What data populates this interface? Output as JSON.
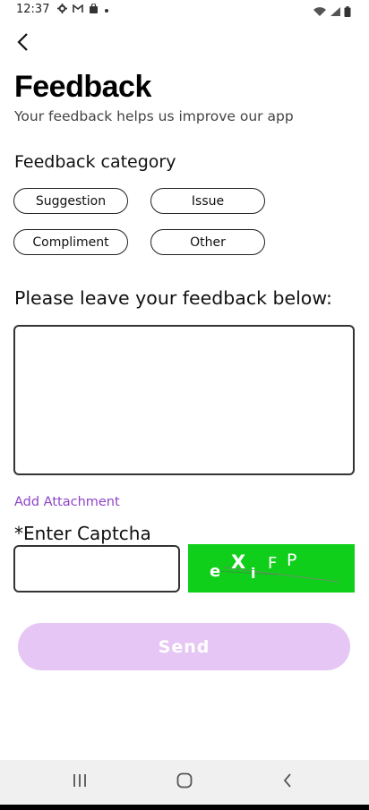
{
  "status_bar": {
    "time": "12:37",
    "left_icons": [
      "gear-icon",
      "gmail-icon",
      "shopping-bag-icon",
      "dot-icon"
    ],
    "right_icons": [
      "wifi-icon",
      "signal-icon",
      "battery-icon"
    ]
  },
  "header": {
    "back_icon": "chevron-left-icon",
    "title": "Feedback",
    "subtitle": "Your feedback helps us improve our app"
  },
  "category": {
    "heading": "Feedback category",
    "options": [
      "Suggestion",
      "Issue",
      "Compliment",
      "Other"
    ]
  },
  "feedback": {
    "heading": "Please leave your feedback below:",
    "value": ""
  },
  "attachment": {
    "label": "Add Attachment"
  },
  "captcha": {
    "label": "*Enter Captcha",
    "value": "",
    "code": "eXiFP",
    "background_color": "#0fcf1a"
  },
  "send": {
    "label": "Send",
    "color": "#e6c6f4"
  },
  "colors": {
    "accent": "#8e44c8",
    "text": "#111111"
  },
  "nav_bar": {
    "icons": [
      "recents-icon",
      "home-icon",
      "back-icon"
    ]
  }
}
